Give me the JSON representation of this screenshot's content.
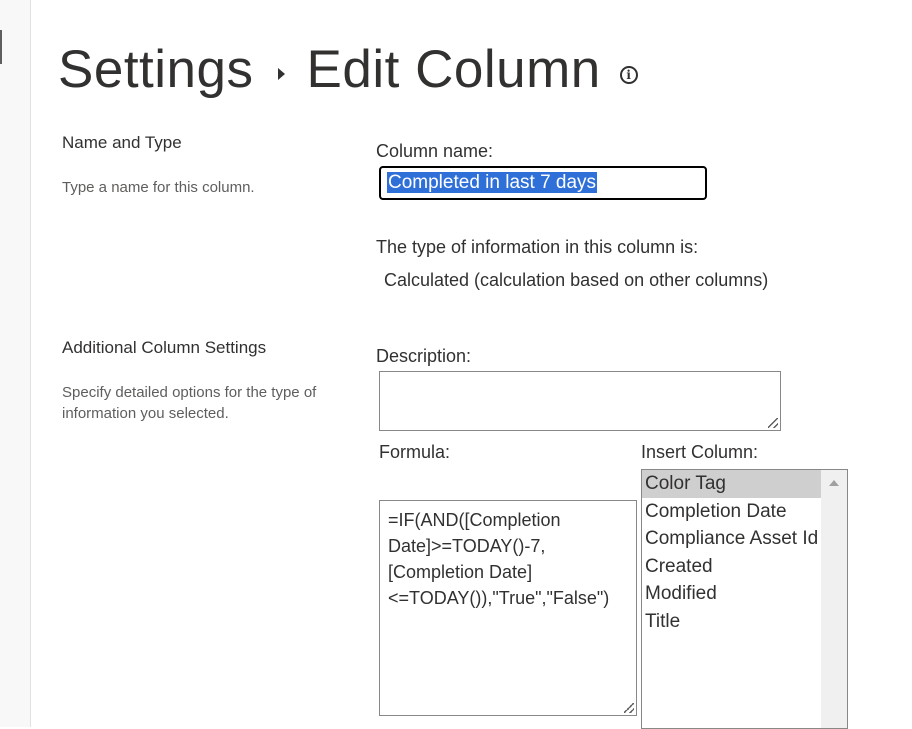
{
  "header": {
    "crumb_settings": "Settings",
    "crumb_edit_column": "Edit Column"
  },
  "name_and_type": {
    "title": "Name and Type",
    "description": "Type a name for this column.",
    "column_name_label": "Column name:",
    "column_name_value": "Completed in last 7 days",
    "type_label": "The type of information in this column is:",
    "type_value": "Calculated (calculation based on other columns)"
  },
  "additional": {
    "title": "Additional Column Settings",
    "description": "Specify detailed options for the type of information you selected.",
    "description_label": "Description:",
    "description_value": "",
    "formula_label": "Formula:",
    "formula_value": "=IF(AND([Completion\nDate]>=TODAY()-7,\n[Completion Date]\n<=TODAY()),\"True\",\"False\")",
    "insert_column_label": "Insert Column:",
    "insert_columns": [
      "Color Tag",
      "Completion Date",
      "Compliance Asset Id",
      "Created",
      "Modified",
      "Title"
    ],
    "selected_column": "Color Tag"
  },
  "colors": {
    "selection_highlight": "#2e6fd8",
    "list_selected": "#cfcfcf"
  }
}
